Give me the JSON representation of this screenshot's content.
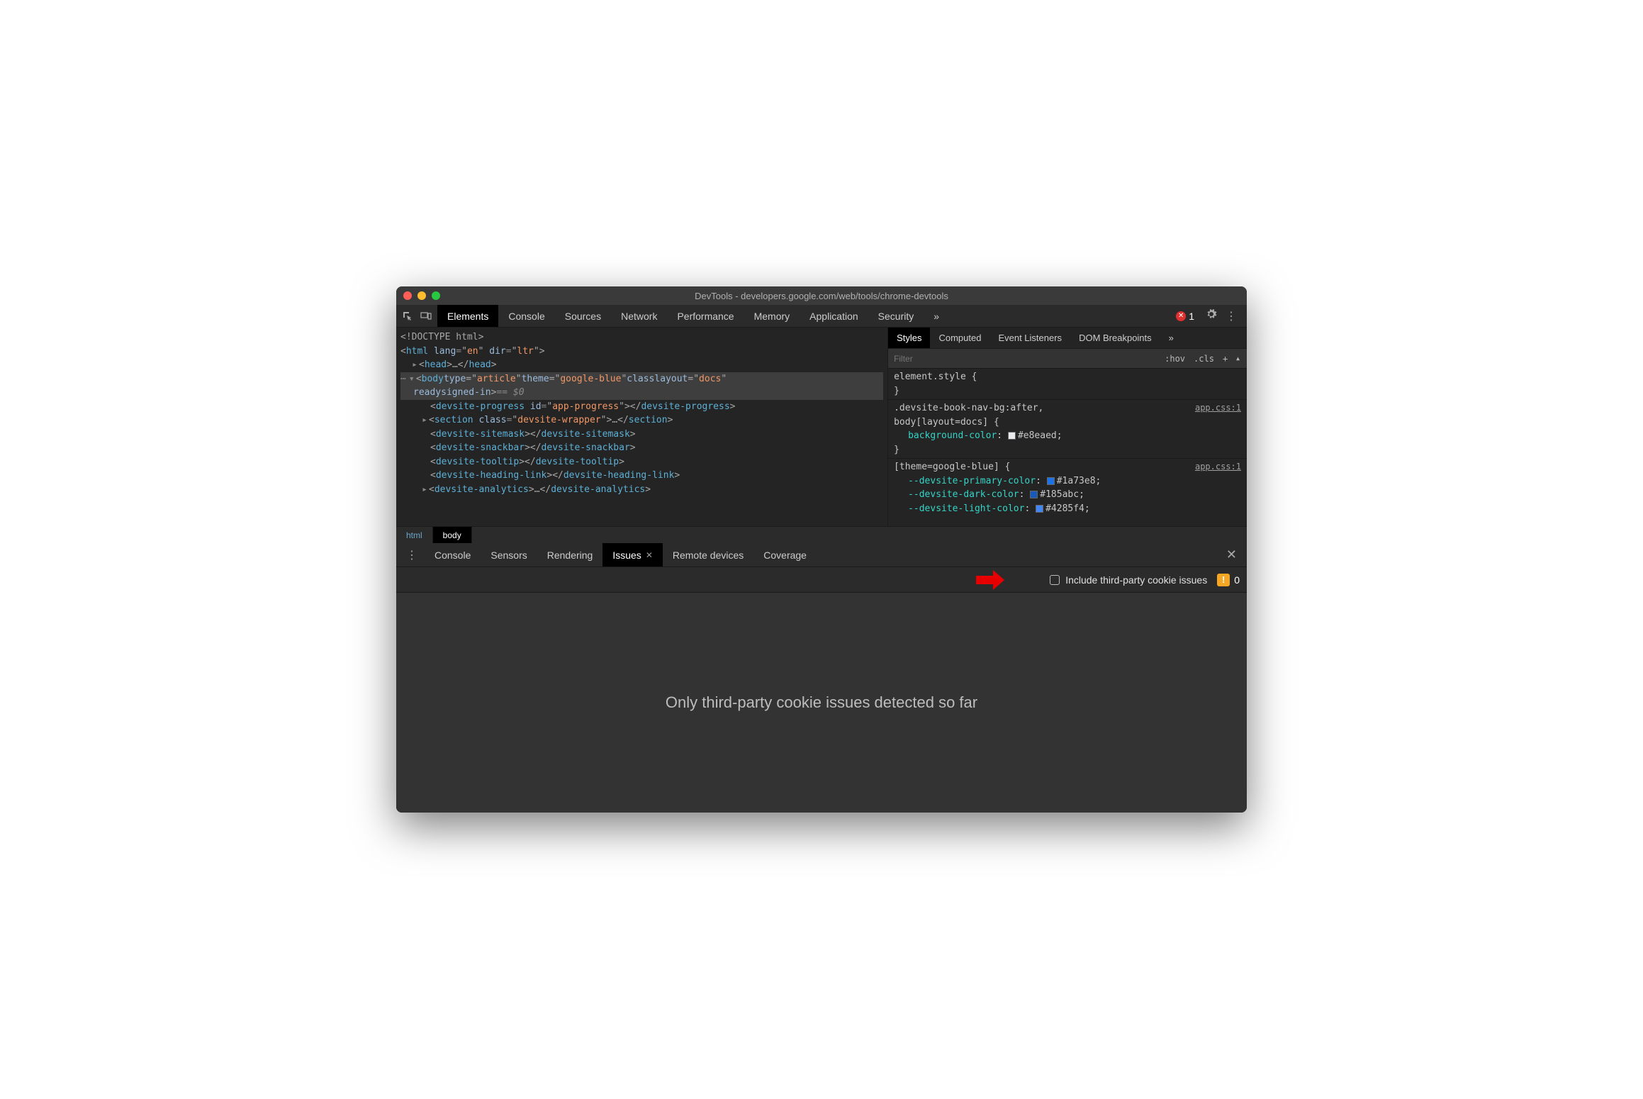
{
  "window": {
    "title": "DevTools - developers.google.com/web/tools/chrome-devtools"
  },
  "toolbar": {
    "tabs": [
      "Elements",
      "Console",
      "Sources",
      "Network",
      "Performance",
      "Memory",
      "Application",
      "Security"
    ],
    "active_tab": "Elements",
    "overflow": "»",
    "error_count": "1"
  },
  "elements": {
    "lines": {
      "doctype": "<!DOCTYPE html>",
      "html_open": "<html lang=\"en\" dir=\"ltr\">",
      "head": "<head>…</head>",
      "body_open_1": "<body type=\"article\" theme=\"google-blue\" class layout=\"docs\"",
      "body_open_2": "ready signed-in>",
      "eq0": " == $0",
      "progress": "<devsite-progress id=\"app-progress\"></devsite-progress>",
      "section": "<section class=\"devsite-wrapper\">…</section>",
      "sitemask": "<devsite-sitemask></devsite-sitemask>",
      "snackbar": "<devsite-snackbar></devsite-snackbar>",
      "tooltip": "<devsite-tooltip></devsite-tooltip>",
      "headinglink": "<devsite-heading-link></devsite-heading-link>",
      "analytics": "<devsite-analytics>…</devsite-analytics>"
    },
    "crumbs": [
      "html",
      "body"
    ],
    "active_crumb": "body"
  },
  "styles": {
    "tabs": [
      "Styles",
      "Computed",
      "Event Listeners",
      "DOM Breakpoints"
    ],
    "active_tab": "Styles",
    "overflow": "»",
    "filter_placeholder": "Filter",
    "hov": ":hov",
    "cls": ".cls",
    "element_style": "element.style {",
    "brace_close": "}",
    "rule1_sel1": ".devsite-book-nav-bg:after,",
    "rule1_sel2": "body[layout=docs] {",
    "rule1_src": "app.css:1",
    "rule1_prop": "background-color",
    "rule1_val": "#e8eaed",
    "rule2_sel": "[theme=google-blue] {",
    "rule2_src": "app.css:1",
    "rule2_props": [
      {
        "name": "--devsite-primary-color",
        "val": "#1a73e8"
      },
      {
        "name": "--devsite-dark-color",
        "val": "#185abc"
      },
      {
        "name": "--devsite-light-color",
        "val": "#4285f4"
      }
    ]
  },
  "drawer": {
    "tabs": [
      "Console",
      "Sensors",
      "Rendering",
      "Issues",
      "Remote devices",
      "Coverage"
    ],
    "active_tab": "Issues",
    "checkbox_label": "Include third-party cookie issues",
    "issues_count": "0",
    "empty_message": "Only third-party cookie issues detected so far"
  }
}
